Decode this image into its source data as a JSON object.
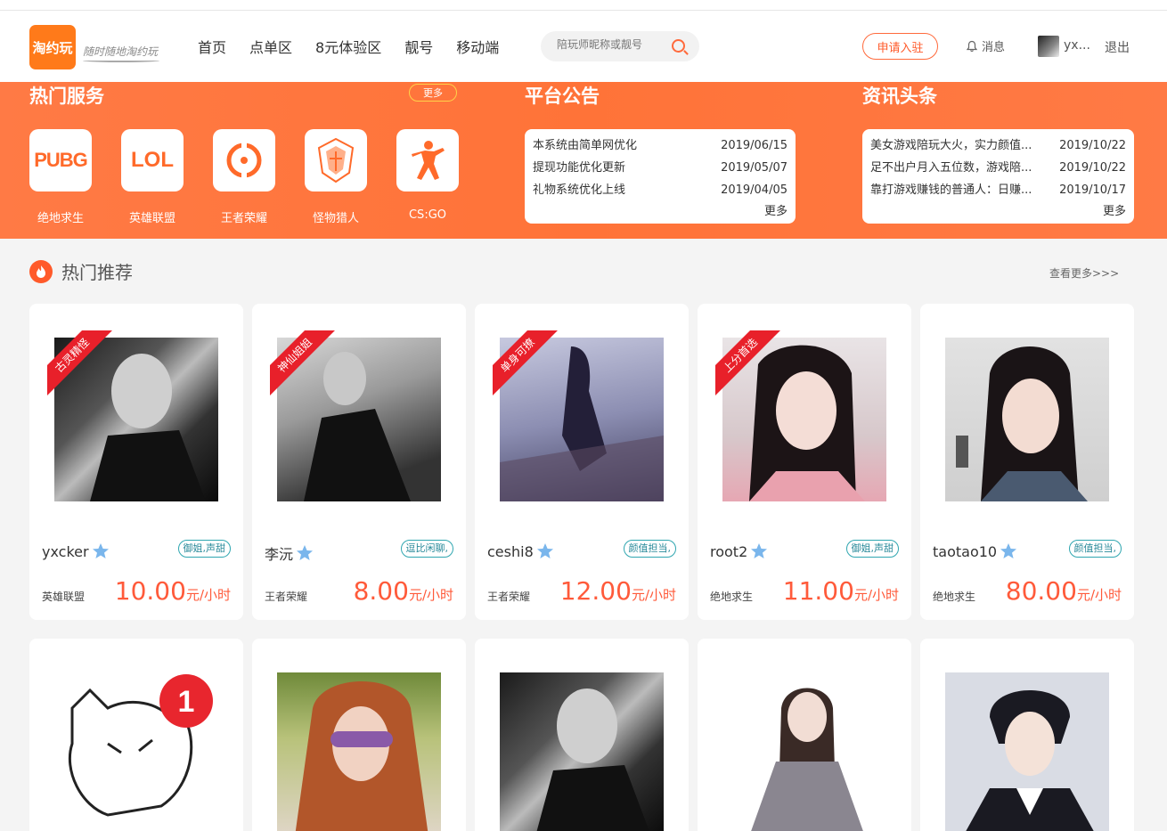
{
  "header": {
    "logo_text": "淘约玩",
    "slogan": "随时随地淘约玩",
    "nav": [
      "首页",
      "点单区",
      "8元体验区",
      "靓号",
      "移动端"
    ],
    "search_placeholder": "陪玩师昵称或靓号",
    "apply_label": "申请入驻",
    "message_label": "消息",
    "user_name": "yx...",
    "logout_label": "退出"
  },
  "hot_services": {
    "title": "热门服务",
    "more_label": "更多",
    "games": [
      {
        "label": "绝地求生",
        "icon_text": "PUBG",
        "icon": "pubg-icon"
      },
      {
        "label": "英雄联盟",
        "icon_text": "LOL",
        "icon": "lol-icon"
      },
      {
        "label": "王者荣耀",
        "icon": "honor-of-kings-icon"
      },
      {
        "label": "怪物猎人",
        "icon": "monster-hunter-icon"
      },
      {
        "label": "CS:GO",
        "icon": "csgo-icon"
      }
    ]
  },
  "announcements": {
    "title": "平台公告",
    "items": [
      {
        "text": "本系统由简单网优化",
        "date": "2019/06/15"
      },
      {
        "text": "提现功能优化更新",
        "date": "2019/05/07"
      },
      {
        "text": "礼物系统优化上线",
        "date": "2019/04/05"
      }
    ],
    "more_label": "更多"
  },
  "news": {
    "title": "资讯头条",
    "items": [
      {
        "text": "美女游戏陪玩大火，实力颜值...",
        "date": "2019/10/22"
      },
      {
        "text": "足不出户月入五位数，游戏陪...",
        "date": "2019/10/22"
      },
      {
        "text": "靠打游戏赚钱的普通人：日赚...",
        "date": "2019/10/17"
      }
    ],
    "more_label": "更多"
  },
  "recommend": {
    "title": "热门推荐",
    "view_more": "查看更多>>>",
    "cards": [
      {
        "ribbon": "古灵精怪",
        "name": "yxcker",
        "tag": "御姐,声甜",
        "game": "英雄联盟",
        "price": "10.00",
        "unit": "元/小时"
      },
      {
        "ribbon": "神仙姐姐",
        "name": "李沅",
        "tag": "逗比闲聊,",
        "game": "王者荣耀",
        "price": "8.00",
        "unit": "元/小时"
      },
      {
        "ribbon": "单身可撩",
        "name": "ceshi8",
        "tag": "颜值担当,",
        "game": "王者荣耀",
        "price": "12.00",
        "unit": "元/小时"
      },
      {
        "ribbon": "上分首选",
        "name": "root2",
        "tag": "御姐,声甜",
        "game": "绝地求生",
        "price": "11.00",
        "unit": "元/小时"
      },
      {
        "ribbon": "",
        "name": "taotao10",
        "tag": "颜值担当,",
        "game": "绝地求生",
        "price": "80.00",
        "unit": "元/小时"
      }
    ],
    "second_row_badge": "1"
  },
  "colors": {
    "accent": "#ff7338",
    "price": "#ff5a3a",
    "ribbon": "#e8202a",
    "tag": "#2fa6b0"
  }
}
